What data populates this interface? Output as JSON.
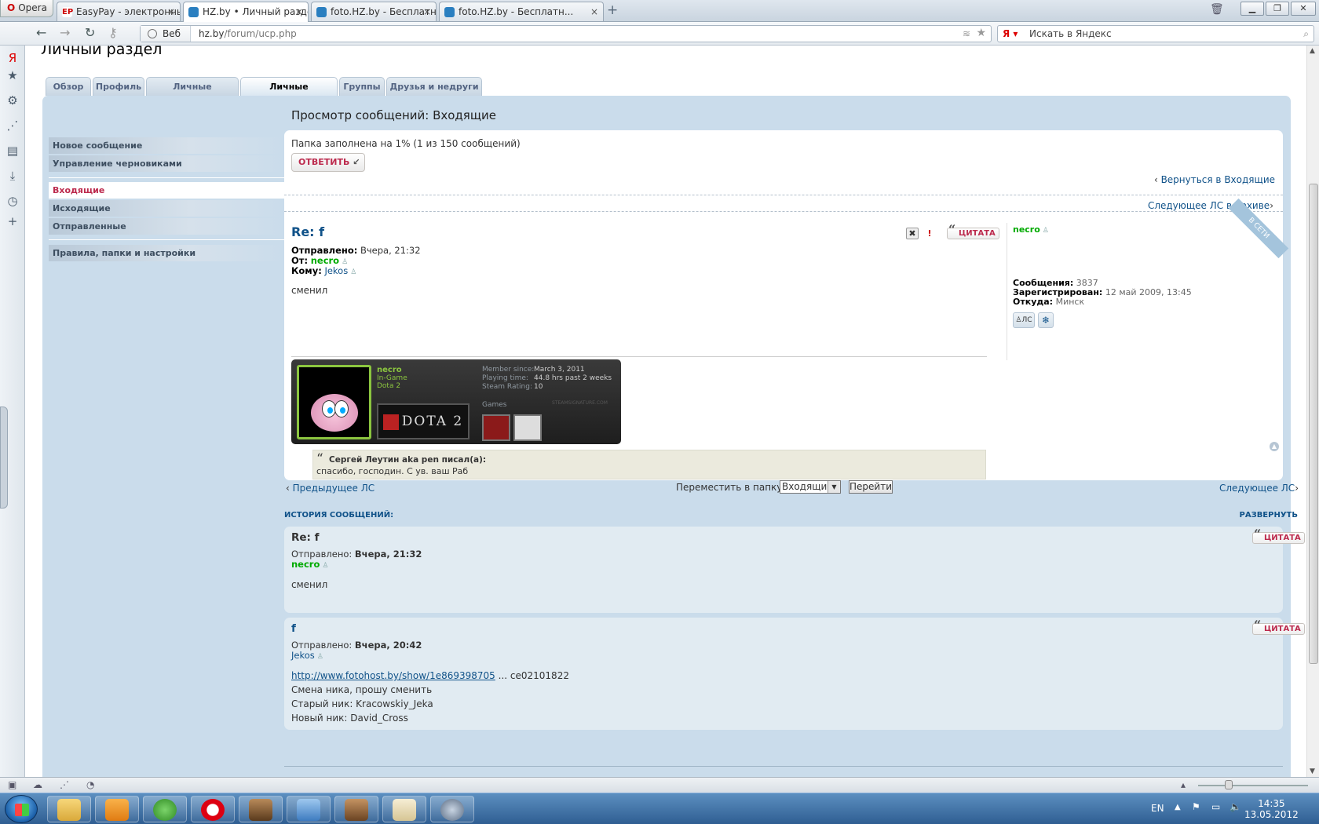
{
  "browser": {
    "opera_label": "Opera",
    "tabs": [
      {
        "title": "EasyPay - электронны...",
        "close": "×"
      },
      {
        "title": "HZ.by • Личный разде...",
        "close": "×"
      },
      {
        "title": "foto.HZ.by - Бесплатн...",
        "close": "×"
      },
      {
        "title": "foto.HZ.by - Бесплатн...",
        "close": "×"
      }
    ],
    "new_tab": "+",
    "web_label": "Веб",
    "url_host": "hz.by",
    "url_path": "/forum/ucp.php",
    "search_placeholder": "Искать в Яндекс"
  },
  "page": {
    "title": "Личный раздел",
    "tabs": [
      "Обзор",
      "Профиль",
      "Личные настройки",
      "Личные сообщения",
      "Группы",
      "Друзья и недруги"
    ],
    "left_menu": {
      "group1": [
        "Новое сообщение",
        "Управление черновиками"
      ],
      "folders": [
        "Входящие",
        "Исходящие",
        "Отправленные"
      ],
      "group3": [
        "Правила, папки и настройки"
      ]
    },
    "heading": "Просмотр сообщений: Входящие",
    "folder_fill": "Папка заполнена на 1% (1 из 150 сообщений)",
    "reply_button": "ОТВЕТИТЬ",
    "reply_icon": "↙",
    "back_link": "Вернуться в Входящие",
    "next_archive": "Следующее ЛС в архиве",
    "online_ribbon": "В СЕТИ",
    "message": {
      "title": "Re: f",
      "sent_label": "Отправлено:",
      "sent_value": "Вчера, 21:32",
      "from_label": "От:",
      "from_value": "necro",
      "to_label": "Кому:",
      "to_value": "Jekos",
      "text": "сменил",
      "quote_button": "ЦИТАТА",
      "quote_mark": "“",
      "delete_icon": "✖",
      "report_icon": "!"
    },
    "steam": {
      "name": "necro",
      "status1": "In-Game",
      "status2": "Dota 2",
      "game_logo": "DOTA 2",
      "member_since_label": "Member since:",
      "member_since_value": "March 3, 2011",
      "playing_label": "Playing time:",
      "playing_value": "44.8 hrs past 2 weeks",
      "rating_label": "Steam Rating:",
      "rating_value": "10",
      "games_label": "Games",
      "watermark": "STEAMSIGNATURE.COM"
    },
    "quote": {
      "author": "Сергей Леутин aka pen писал(а):",
      "text": "спасибо, господин. С ув. ваш Раб"
    },
    "profile": {
      "name": "necro",
      "posts_label": "Сообщения:",
      "posts_value": "3837",
      "reg_label": "Зарегистрирован:",
      "reg_value": "12 май 2009, 13:45",
      "from_label": "Откуда:",
      "from_value": "Минск",
      "pm_button": "ЛС"
    },
    "nav": {
      "prev": "Предыдущее ЛС",
      "next": "Следующее ЛС",
      "move_label": "Переместить в папку:",
      "move_value": "Входящие",
      "go_button": "Перейти"
    },
    "history": {
      "label": "ИСТОРИЯ СООБЩЕНИЙ:",
      "expand": "РАЗВЕРНУТЬ",
      "items": [
        {
          "title": "Re: f",
          "sent_label": "Отправлено:",
          "sent_value": "Вчера, 21:32",
          "author": "necro",
          "lines": [
            "сменил"
          ]
        },
        {
          "title": "f",
          "sent_label": "Отправлено:",
          "sent_value": "Вчера, 20:42",
          "author": "Jekos",
          "link": "http://www.fotohost.by/show/1e869398705",
          "link_tail": "... ce02101822",
          "lines": [
            "Смена ника, прошу сменить",
            "Старый ник: Kracowskiy_Jeka",
            "Новый ник: David_Cross"
          ]
        }
      ]
    }
  },
  "taskbar": {
    "lang": "EN",
    "time": "14:35",
    "date": "13.05.2012"
  },
  "colors": {
    "panel": "#cadceb",
    "link": "#105289",
    "accent": "#bc2a4d",
    "online": "#00aa00"
  }
}
